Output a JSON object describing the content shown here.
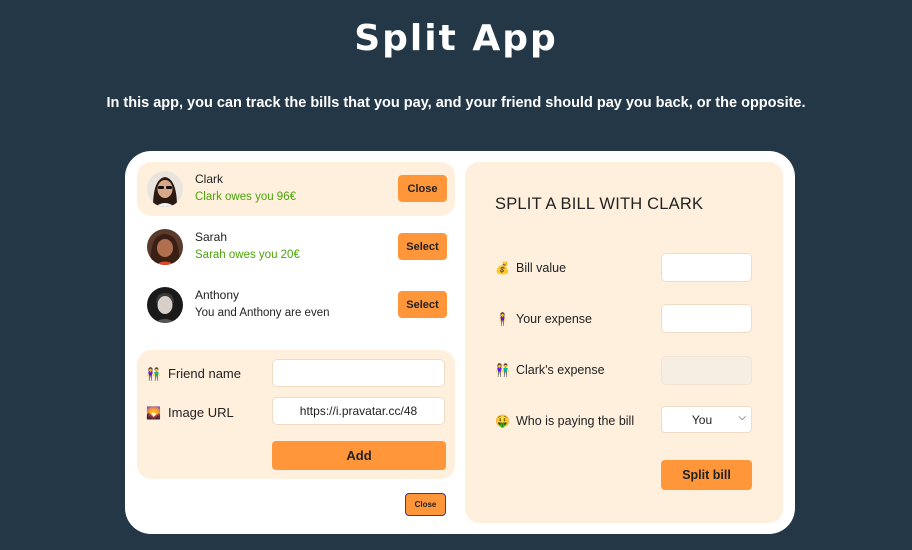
{
  "app": {
    "title": "Split App",
    "subtitle": "In this app, you can track the bills that you pay, and your friend should pay you back, or the opposite."
  },
  "friends": [
    {
      "name": "Clark",
      "status": "Clark owes you 96€",
      "button": "Close",
      "selected": true,
      "status_color": "#4ba30a"
    },
    {
      "name": "Sarah",
      "status": "Sarah owes you 20€",
      "button": "Select",
      "selected": false,
      "status_color": "#4ba30a"
    },
    {
      "name": "Anthony",
      "status": "You and Anthony are even",
      "button": "Select",
      "selected": false,
      "status_color": "#222222"
    }
  ],
  "add_friend_form": {
    "name_icon": "👫",
    "name_label": "Friend name",
    "name_value": "",
    "url_icon": "🌄",
    "url_label": "Image URL",
    "url_value": "https://i.pravatar.cc/48",
    "add_button": "Add"
  },
  "close_form_button": "Close",
  "split_form": {
    "title": "SPLIT A BILL WITH CLARK",
    "bill_icon": "💰",
    "bill_label": "Bill value",
    "bill_value": "",
    "your_icon": "🧍‍♀️",
    "your_label": "Your expense",
    "your_value": "",
    "friend_icon": "👫",
    "friend_label": "Clark's expense",
    "friend_value": "",
    "payer_icon": "🤑",
    "payer_label": "Who is paying the bill",
    "payer_selected": "You",
    "split_button": "Split bill"
  },
  "colors": {
    "background": "#243747",
    "accent": "#ff963a",
    "panel": "#fff0de",
    "positive": "#4ba30a"
  }
}
